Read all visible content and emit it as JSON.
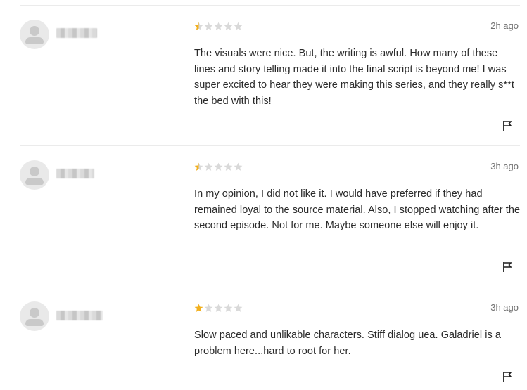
{
  "colors": {
    "star_filled": "#f2b01e",
    "star_empty": "#d9d9d9",
    "divider": "#ebebeb",
    "timestamp": "#6f6f6f",
    "text": "#2b2b2b"
  },
  "reviews": [
    {
      "rating": 0.5,
      "max_rating": 5,
      "timestamp": "2h ago",
      "text": "The visuals were nice. But, the writing is awful. How many of these lines and story telling made it into the final script is beyond me! I was super excited to hear they were making this series, and they really s**t the bed with this!",
      "avatar_icon": "user-avatar-icon",
      "flag_icon": "flag-icon"
    },
    {
      "rating": 0.5,
      "max_rating": 5,
      "timestamp": "3h ago",
      "text": "In my opinion, I did not like it. I would have preferred if they had remained loyal to the source material. Also, I stopped watching after the second episode. Not for me. Maybe someone else will enjoy it.",
      "avatar_icon": "user-avatar-icon",
      "flag_icon": "flag-icon"
    },
    {
      "rating": 1,
      "max_rating": 5,
      "timestamp": "3h ago",
      "text": "Slow paced and unlikable characters. Stiff dialog uea. Galadriel is a problem here...hard to root for her.",
      "avatar_icon": "user-avatar-icon",
      "flag_icon": "flag-icon"
    }
  ]
}
